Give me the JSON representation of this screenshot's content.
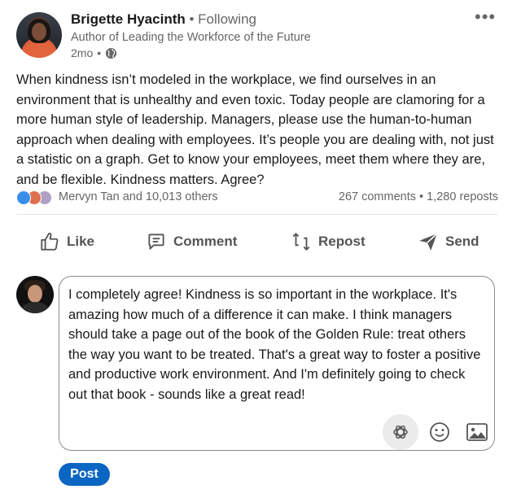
{
  "post": {
    "author_name": "Brigette Hyacinth",
    "separator": "•",
    "follow_status": "Following",
    "headline": "Author of Leading the Workforce of the Future",
    "time": "2mo",
    "time_separator": "•",
    "more_label": "•••",
    "body": "When kindness isn’t modeled in the workplace, we find ourselves in an environment that is unhealthy and even toxic. Today people are clamoring for a more human style of leadership. Managers, please use the human-to-human approach when dealing with employees. It’s people you are dealing with, not just a statistic on a graph. Get to know your employees, meet them where they are, and be flexible. Kindness matters. Agree?",
    "reactions_text": "Mervyn Tan and 10,013 others",
    "comments_count": "267 comments",
    "counts_separator": "•",
    "reposts_count": "1,280 reposts"
  },
  "actions": {
    "like": "Like",
    "comment": "Comment",
    "repost": "Repost",
    "send": "Send"
  },
  "comment_draft": {
    "text": "I completely agree! Kindness is so important in the workplace. It's amazing how much of a difference it can make. I think managers should take a page out of the book of the Golden Rule: treat others the way you want to be treated. That's a great way to foster a positive and productive work environment. And I'm definitely going to check out that book - sounds like a great read!",
    "post_label": "Post"
  },
  "icons": {
    "globe": "globe-icon",
    "like": "thumbs-up-icon",
    "comment": "comment-icon",
    "repost": "repost-icon",
    "send": "send-icon",
    "ai": "openai-icon",
    "emoji": "emoji-icon",
    "image": "image-icon"
  },
  "colors": {
    "accent": "#0a66c2",
    "reaction_like": "#378fe9",
    "reaction_love": "#df704d",
    "reaction_support": "#b0a1c4"
  }
}
